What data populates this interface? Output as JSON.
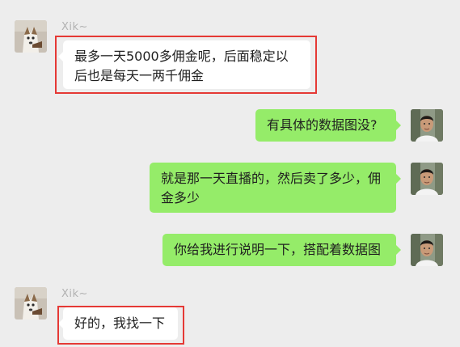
{
  "messages": [
    {
      "side": "left",
      "sender": "Xik~",
      "text": "最多一天5000多佣金呢，后面稳定以后也是每天一两千佣金",
      "avatar_icon": "dog-avatar-icon"
    },
    {
      "side": "right",
      "text": "有具体的数据图没?",
      "avatar_icon": "man-avatar-icon"
    },
    {
      "side": "right",
      "text": "就是那一天直播的，然后卖了多少，佣金多少",
      "avatar_icon": "man-avatar-icon"
    },
    {
      "side": "right",
      "text": "你给我进行说明一下，搭配着数据图",
      "avatar_icon": "man-avatar-icon"
    },
    {
      "side": "left",
      "sender": "Xik~",
      "text": "好的，我找一下",
      "avatar_icon": "dog-avatar-icon"
    }
  ],
  "colors": {
    "background": "#ededed",
    "left_bubble": "#ffffff",
    "right_bubble": "#95ec69",
    "highlight_box": "#e53935"
  }
}
